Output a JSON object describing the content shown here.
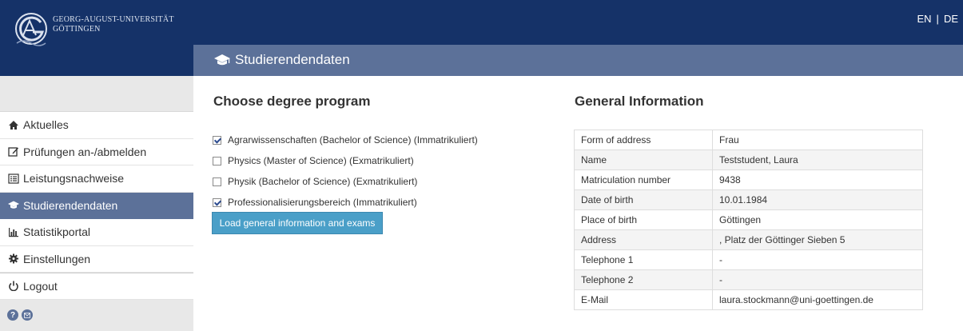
{
  "header": {
    "logo_line1": "GEORG-AUGUST-UNIVERSITÄT",
    "logo_line2": "GÖTTINGEN",
    "lang_en": "EN",
    "lang_sep": "|",
    "lang_de": "DE",
    "page_title": "Studierendendaten",
    "bar_color": "#153268",
    "accent_color": "#5c7199"
  },
  "sidebar": {
    "items": [
      {
        "label": "Aktuelles",
        "icon": "home-icon"
      },
      {
        "label": "Prüfungen an-/abmelden",
        "icon": "edit-icon"
      },
      {
        "label": "Leistungsnachweise",
        "icon": "list-icon"
      },
      {
        "label": "Studierendendaten",
        "icon": "graduation-cap-icon",
        "active": true
      },
      {
        "label": "Statistikportal",
        "icon": "bar-chart-icon"
      },
      {
        "label": "Einstellungen",
        "icon": "gear-icon"
      },
      {
        "label": "Logout",
        "icon": "power-icon"
      }
    ],
    "footer_icons": [
      "help-icon",
      "mail-icon"
    ],
    "help_glyph": "?"
  },
  "degrees": {
    "heading": "Choose degree program",
    "items": [
      {
        "label": "Agrarwissenschaften (Bachelor of Science) (Immatrikuliert)",
        "checked": true
      },
      {
        "label": "Physics (Master of Science) (Exmatrikuliert)",
        "checked": false
      },
      {
        "label": "Physik (Bachelor of Science) (Exmatrikuliert)",
        "checked": false
      },
      {
        "label": "Professionalisierungsbereich (Immatrikuliert)",
        "checked": true
      }
    ],
    "button_label": "Load general information and exams",
    "button_color": "#4a9fc8"
  },
  "general": {
    "heading": "General Information",
    "rows": [
      {
        "key": "Form of address",
        "value": "Frau"
      },
      {
        "key": "Name",
        "value": "Teststudent, Laura"
      },
      {
        "key": "Matriculation number",
        "value": "9438"
      },
      {
        "key": "Date of birth",
        "value": "10.01.1984"
      },
      {
        "key": "Place of birth",
        "value": "Göttingen"
      },
      {
        "key": "Address",
        "value": ", Platz der Göttinger Sieben 5"
      },
      {
        "key": "Telephone 1",
        "value": "-"
      },
      {
        "key": "Telephone 2",
        "value": "-"
      },
      {
        "key": "E-Mail",
        "value": "laura.stockmann@uni-goettingen.de"
      }
    ]
  }
}
